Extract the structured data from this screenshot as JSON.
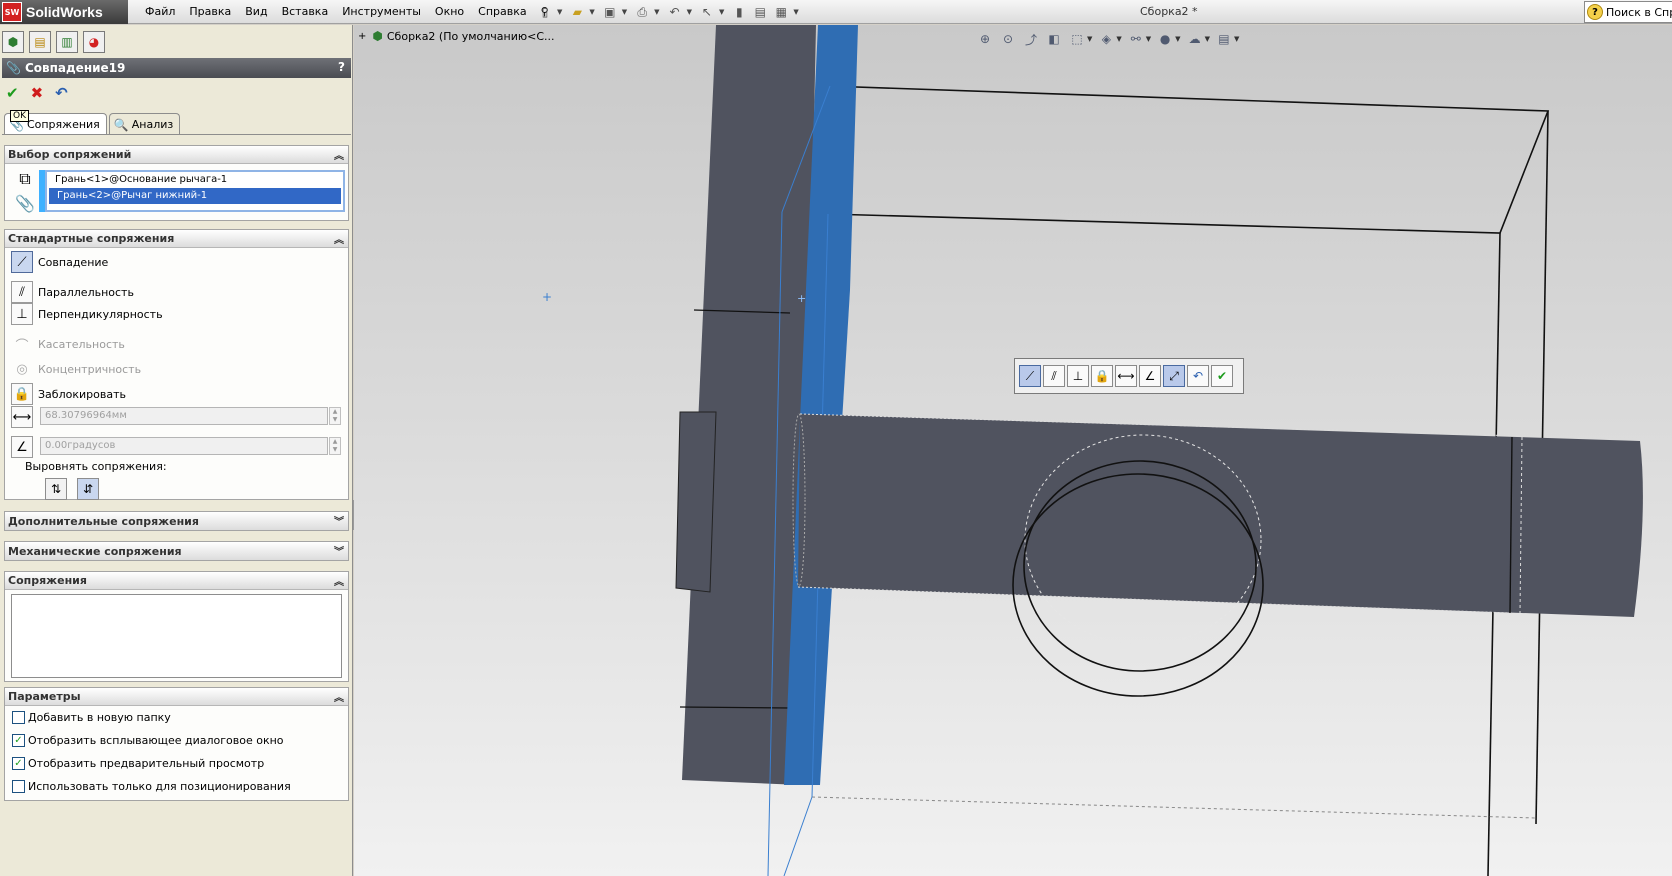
{
  "app": {
    "logo_badge": "SW",
    "logo_text": "SolidWorks",
    "doc_title": "Сборка2 *"
  },
  "menu": [
    "Файл",
    "Правка",
    "Вид",
    "Вставка",
    "Инструменты",
    "Окно",
    "Справка"
  ],
  "search": {
    "text": "Поиск в Спр"
  },
  "pm": {
    "title": "Совпадение19",
    "help": "?",
    "ok_tooltip": "OK",
    "tabs": {
      "mates": "Сопряжения",
      "analysis": "Анализ"
    },
    "mate_selection": {
      "title": "Выбор сопряжений",
      "items": [
        "Грань<1>@Основание рычага-1",
        "Грань<2>@Рычаг нижний-1"
      ]
    },
    "standard_mates": {
      "title": "Стандартные сопряжения",
      "coincident": "Совпадение",
      "parallel": "Параллельность",
      "perpendicular": "Перпендикулярность",
      "tangent": "Касательность",
      "concentric": "Концентричность",
      "lock": "Заблокировать",
      "distance_value": "68.30796964мм",
      "angle_value": "0.00градусов",
      "align_label": "Выровнять сопряжения:"
    },
    "advanced_mates": {
      "title": "Дополнительные сопряжения"
    },
    "mechanical_mates": {
      "title": "Механические сопряжения"
    },
    "mates_list": {
      "title": "Сопряжения"
    },
    "options": {
      "title": "Параметры",
      "add_to_folder": "Добавить в новую папку",
      "show_popup": "Отобразить всплывающее диалоговое окно",
      "show_preview": "Отобразить предварительный просмотр",
      "positioning_only": "Использовать только для позиционирования"
    }
  },
  "tree": {
    "root_label": "Сборка2  (По умолчанию<С..."
  },
  "colors": {
    "selected_face": "#2f6db3",
    "part_body": "#50535f",
    "accent": "#3168c6"
  }
}
